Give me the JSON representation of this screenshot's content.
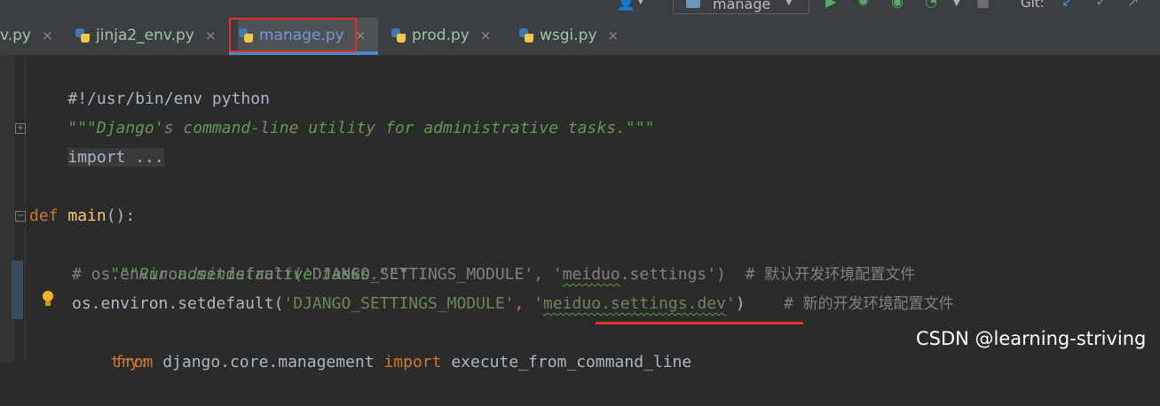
{
  "toolbar": {
    "run_config": "manage",
    "git_label": "Git:"
  },
  "tabs": [
    {
      "label": "v.py"
    },
    {
      "label": "jinja2_env.py"
    },
    {
      "label": "manage.py",
      "active": true
    },
    {
      "label": "prod.py"
    },
    {
      "label": "wsgi.py"
    }
  ],
  "close_glyph": "×",
  "editor": {
    "lines": {
      "l1": "#!/usr/bin/env python",
      "l2": "\"\"\"Django's command-line utility for administrative tasks.\"\"\"",
      "l3": "import ...",
      "l6_kw": "def",
      "l6_fn": "main",
      "l6_rest": "():",
      "l7": "\"\"\"Run administrative tasks.\"\"\"",
      "l8_a": "# os.environ.setdefault('DJANGO_SETTINGS_MODULE', '",
      "l8_b": "meiduo",
      "l8_c": ".settings')  # ",
      "l8_cn": "默认开发环境配置文件",
      "l9_a": "os.environ.setdefault(",
      "l9_b": "'DJANGO_SETTINGS_MODULE'",
      "l9_c": ", ",
      "l9_d": "'",
      "l9_e": "meiduo.settings.dev",
      "l9_f": "'",
      "l9_g": ")",
      "l9_h": "    # ",
      "l9_cn": "新的开发环境配置文件",
      "l10": "try:",
      "l11_kw1": "from",
      "l11_mid": " django.core.management ",
      "l11_kw2": "import",
      "l11_end": " execute_from_command_line"
    }
  },
  "watermark": "CSDN @learning-striving",
  "colors": {
    "background": "#2b2b2b",
    "keyword": "#cc7832",
    "function": "#ffc66d",
    "string": "#6a8759",
    "docstring": "#629755",
    "comment": "#808080",
    "highlight": "#e03030"
  }
}
